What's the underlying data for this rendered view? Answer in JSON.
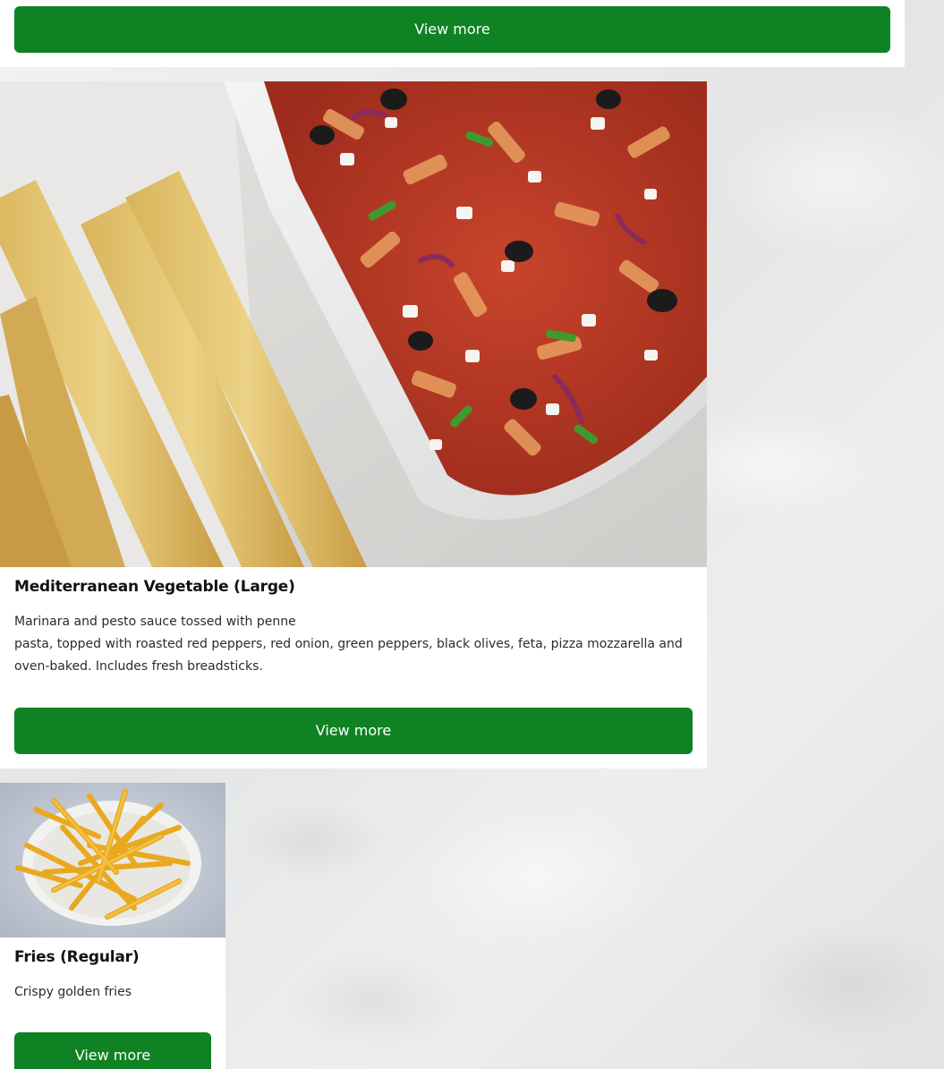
{
  "items": [
    {
      "button_label": "View more"
    },
    {
      "image_alt": "Mediterranean vegetable pasta bake with breadsticks",
      "title": "Mediterranean Vegetable (Large)",
      "description_line1": "Marinara and pesto sauce tossed with penne",
      "description_rest": "pasta, topped with roasted red peppers, red onion, green peppers, black olives, feta, pizza mozzarella and oven-baked. Includes fresh breadsticks.",
      "button_label": "View more"
    },
    {
      "image_alt": "Bowl of french fries",
      "title": "Fries (Regular)",
      "description": "Crispy golden fries",
      "button_label": "View more"
    }
  ],
  "colors": {
    "button_bg": "#0f8323",
    "button_text": "#ffffff",
    "card_bg": "#ffffff",
    "title_text": "#111111"
  }
}
